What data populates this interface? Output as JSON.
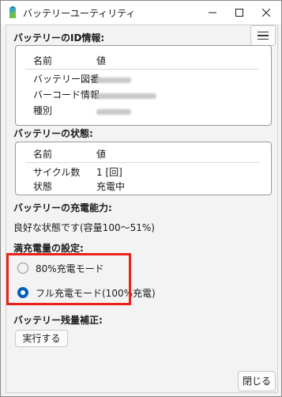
{
  "window": {
    "title": "バッテリーユーティリティ",
    "menu_icon": "hamburger-menu-icon",
    "app_icon": "battery-utility-icon"
  },
  "id_info": {
    "title": "バッテリーのID情報:",
    "header": {
      "name": "名前",
      "value": "値"
    },
    "rows": [
      {
        "name": "バッテリー図番",
        "value": ""
      },
      {
        "name": "バーコード情報",
        "value": ""
      },
      {
        "name": "種別",
        "value": ""
      }
    ]
  },
  "state": {
    "title": "バッテリーの状態:",
    "header": {
      "name": "名前",
      "value": "値"
    },
    "rows": [
      {
        "name": "サイクル数",
        "value": "1 [回]"
      },
      {
        "name": "状態",
        "value": "充電中"
      }
    ]
  },
  "capacity": {
    "title": "バッテリーの充電能力:",
    "text": "良好な状態です(容量100～51%)"
  },
  "charge_setting": {
    "title": "満充電量の設定:",
    "options": [
      {
        "label": "80%充電モード",
        "selected": false
      },
      {
        "label": "フル充電モード(100%充電)",
        "selected": true
      }
    ],
    "highlight_color": "#e8231b"
  },
  "calibration": {
    "title": "バッテリー残量補正:",
    "button": "実行する"
  },
  "footer": {
    "close_button": "閉じる"
  },
  "colors": {
    "accent": "#005fb8"
  }
}
